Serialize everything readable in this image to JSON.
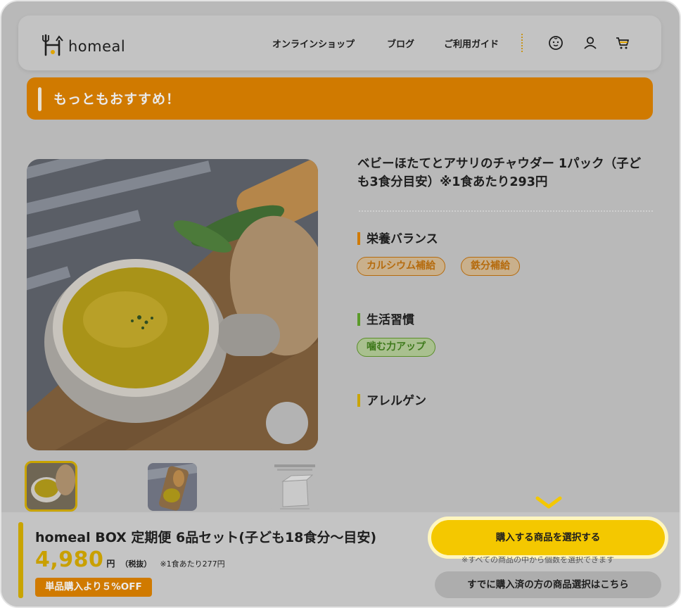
{
  "header": {
    "logo_text": "homeal",
    "nav": [
      "オンラインショップ",
      "ブログ",
      "ご利用ガイド"
    ],
    "icons": [
      "face-icon",
      "user-icon",
      "cart-icon"
    ]
  },
  "banner": {
    "text": "もっともおすすめ！"
  },
  "product": {
    "title": "ベビーほたてとアサリのチャウダー 1パック（子ども3食分目安）※1食あたり293円",
    "sections": [
      {
        "heading": "栄養バランス",
        "accent": "#d07a00",
        "tags": [
          "カルシウム補給",
          "鉄分補給"
        ]
      },
      {
        "heading": "生活習慣",
        "accent": "#5b9a2a",
        "tags": [
          "噛む力アップ"
        ]
      },
      {
        "heading": "アレルゲン",
        "accent": "#c9a400",
        "tags": []
      }
    ]
  },
  "bottom_bar": {
    "title": "homeal BOX 定期便 6品セット(子ども18食分〜目安)",
    "price": "4,980",
    "price_unit": "円",
    "tax": "（税抜）",
    "per_meal": "※1食あたり277円",
    "discount": "単品購入より５%OFF",
    "select_button": "購入する商品を選択する",
    "note": "※すべての商品の中から個数を選択できます",
    "purchased_button": "すでに購入済の方の商品選択はこちら"
  },
  "colors": {
    "brand_orange": "#d07a00",
    "brand_yellow": "#f4c800",
    "green": "#5b9a2a"
  }
}
